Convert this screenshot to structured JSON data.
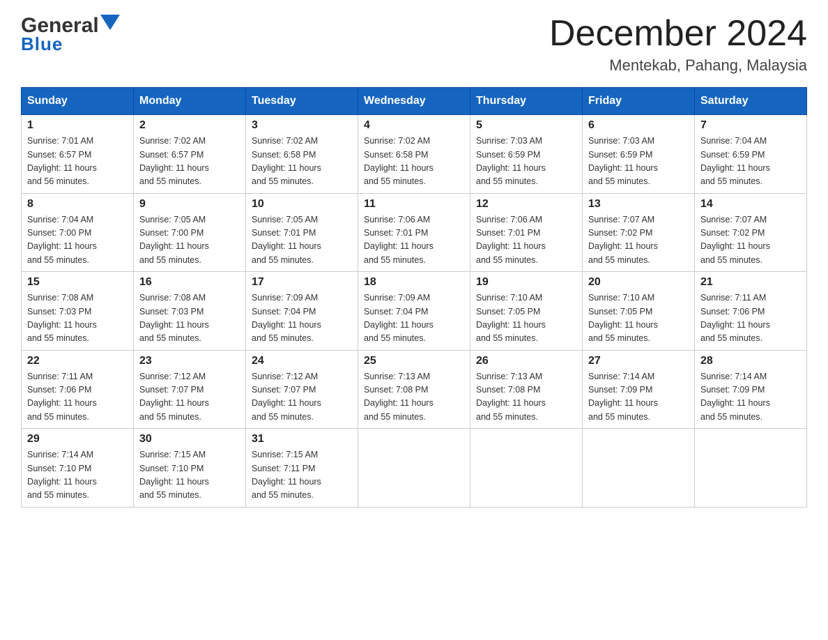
{
  "header": {
    "logo": {
      "line1": "General",
      "line2": "Blue"
    },
    "title": "December 2024",
    "subtitle": "Mentekab, Pahang, Malaysia"
  },
  "calendar": {
    "days_of_week": [
      "Sunday",
      "Monday",
      "Tuesday",
      "Wednesday",
      "Thursday",
      "Friday",
      "Saturday"
    ],
    "weeks": [
      [
        {
          "day": "1",
          "sunrise": "7:01 AM",
          "sunset": "6:57 PM",
          "daylight": "11 hours and 56 minutes."
        },
        {
          "day": "2",
          "sunrise": "7:02 AM",
          "sunset": "6:57 PM",
          "daylight": "11 hours and 55 minutes."
        },
        {
          "day": "3",
          "sunrise": "7:02 AM",
          "sunset": "6:58 PM",
          "daylight": "11 hours and 55 minutes."
        },
        {
          "day": "4",
          "sunrise": "7:02 AM",
          "sunset": "6:58 PM",
          "daylight": "11 hours and 55 minutes."
        },
        {
          "day": "5",
          "sunrise": "7:03 AM",
          "sunset": "6:59 PM",
          "daylight": "11 hours and 55 minutes."
        },
        {
          "day": "6",
          "sunrise": "7:03 AM",
          "sunset": "6:59 PM",
          "daylight": "11 hours and 55 minutes."
        },
        {
          "day": "7",
          "sunrise": "7:04 AM",
          "sunset": "6:59 PM",
          "daylight": "11 hours and 55 minutes."
        }
      ],
      [
        {
          "day": "8",
          "sunrise": "7:04 AM",
          "sunset": "7:00 PM",
          "daylight": "11 hours and 55 minutes."
        },
        {
          "day": "9",
          "sunrise": "7:05 AM",
          "sunset": "7:00 PM",
          "daylight": "11 hours and 55 minutes."
        },
        {
          "day": "10",
          "sunrise": "7:05 AM",
          "sunset": "7:01 PM",
          "daylight": "11 hours and 55 minutes."
        },
        {
          "day": "11",
          "sunrise": "7:06 AM",
          "sunset": "7:01 PM",
          "daylight": "11 hours and 55 minutes."
        },
        {
          "day": "12",
          "sunrise": "7:06 AM",
          "sunset": "7:01 PM",
          "daylight": "11 hours and 55 minutes."
        },
        {
          "day": "13",
          "sunrise": "7:07 AM",
          "sunset": "7:02 PM",
          "daylight": "11 hours and 55 minutes."
        },
        {
          "day": "14",
          "sunrise": "7:07 AM",
          "sunset": "7:02 PM",
          "daylight": "11 hours and 55 minutes."
        }
      ],
      [
        {
          "day": "15",
          "sunrise": "7:08 AM",
          "sunset": "7:03 PM",
          "daylight": "11 hours and 55 minutes."
        },
        {
          "day": "16",
          "sunrise": "7:08 AM",
          "sunset": "7:03 PM",
          "daylight": "11 hours and 55 minutes."
        },
        {
          "day": "17",
          "sunrise": "7:09 AM",
          "sunset": "7:04 PM",
          "daylight": "11 hours and 55 minutes."
        },
        {
          "day": "18",
          "sunrise": "7:09 AM",
          "sunset": "7:04 PM",
          "daylight": "11 hours and 55 minutes."
        },
        {
          "day": "19",
          "sunrise": "7:10 AM",
          "sunset": "7:05 PM",
          "daylight": "11 hours and 55 minutes."
        },
        {
          "day": "20",
          "sunrise": "7:10 AM",
          "sunset": "7:05 PM",
          "daylight": "11 hours and 55 minutes."
        },
        {
          "day": "21",
          "sunrise": "7:11 AM",
          "sunset": "7:06 PM",
          "daylight": "11 hours and 55 minutes."
        }
      ],
      [
        {
          "day": "22",
          "sunrise": "7:11 AM",
          "sunset": "7:06 PM",
          "daylight": "11 hours and 55 minutes."
        },
        {
          "day": "23",
          "sunrise": "7:12 AM",
          "sunset": "7:07 PM",
          "daylight": "11 hours and 55 minutes."
        },
        {
          "day": "24",
          "sunrise": "7:12 AM",
          "sunset": "7:07 PM",
          "daylight": "11 hours and 55 minutes."
        },
        {
          "day": "25",
          "sunrise": "7:13 AM",
          "sunset": "7:08 PM",
          "daylight": "11 hours and 55 minutes."
        },
        {
          "day": "26",
          "sunrise": "7:13 AM",
          "sunset": "7:08 PM",
          "daylight": "11 hours and 55 minutes."
        },
        {
          "day": "27",
          "sunrise": "7:14 AM",
          "sunset": "7:09 PM",
          "daylight": "11 hours and 55 minutes."
        },
        {
          "day": "28",
          "sunrise": "7:14 AM",
          "sunset": "7:09 PM",
          "daylight": "11 hours and 55 minutes."
        }
      ],
      [
        {
          "day": "29",
          "sunrise": "7:14 AM",
          "sunset": "7:10 PM",
          "daylight": "11 hours and 55 minutes."
        },
        {
          "day": "30",
          "sunrise": "7:15 AM",
          "sunset": "7:10 PM",
          "daylight": "11 hours and 55 minutes."
        },
        {
          "day": "31",
          "sunrise": "7:15 AM",
          "sunset": "7:11 PM",
          "daylight": "11 hours and 55 minutes."
        },
        null,
        null,
        null,
        null
      ]
    ],
    "labels": {
      "sunrise": "Sunrise:",
      "sunset": "Sunset:",
      "daylight": "Daylight:"
    }
  }
}
